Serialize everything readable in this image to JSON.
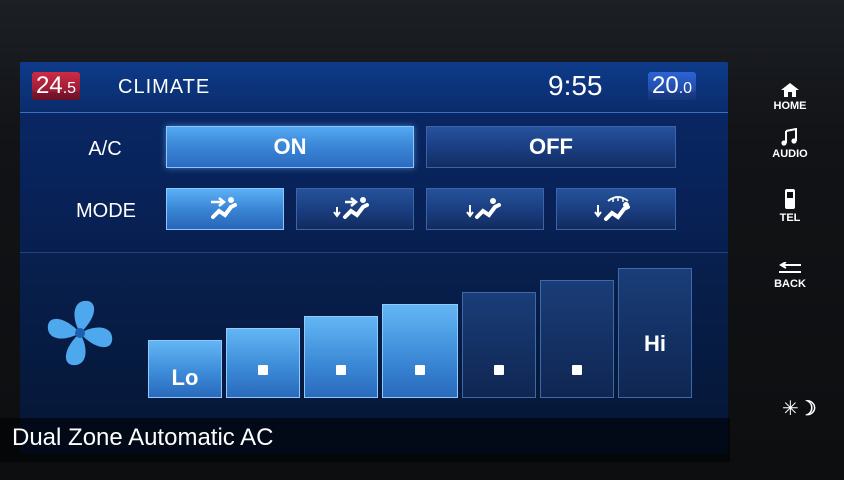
{
  "header": {
    "left_temp_int": "24",
    "left_temp_dec": ".5",
    "title": "CLIMATE",
    "clock": "9:55",
    "right_temp_int": "20",
    "right_temp_dec": ".0"
  },
  "ac": {
    "label": "A/C",
    "on_label": "ON",
    "off_label": "OFF",
    "state": "ON"
  },
  "mode": {
    "label": "MODE",
    "options": [
      {
        "icon": "vent-face-icon",
        "selected": true
      },
      {
        "icon": "vent-face-feet-icon",
        "selected": false
      },
      {
        "icon": "vent-feet-icon",
        "selected": false
      },
      {
        "icon": "vent-feet-defrost-icon",
        "selected": false
      }
    ]
  },
  "fan": {
    "icon": "fan-icon",
    "levels": [
      {
        "label": "Lo",
        "on": true
      },
      {
        "label": "",
        "on": true
      },
      {
        "label": "",
        "on": true
      },
      {
        "label": "",
        "on": true
      },
      {
        "label": "",
        "on": false
      },
      {
        "label": "",
        "on": false
      },
      {
        "label": "Hi",
        "on": false
      }
    ],
    "current_level": 4,
    "max_level": 7
  },
  "side_buttons": {
    "home": "HOME",
    "audio": "AUDIO",
    "tel": "TEL",
    "back": "BACK",
    "brightness_icon": "sun-moon-icon"
  },
  "caption": "Dual Zone Automatic AC",
  "colors": {
    "accent_active": "#3c88d8",
    "panel_bg": "#082258",
    "left_temp": "#cf2b44",
    "right_temp": "#2c64d6"
  }
}
